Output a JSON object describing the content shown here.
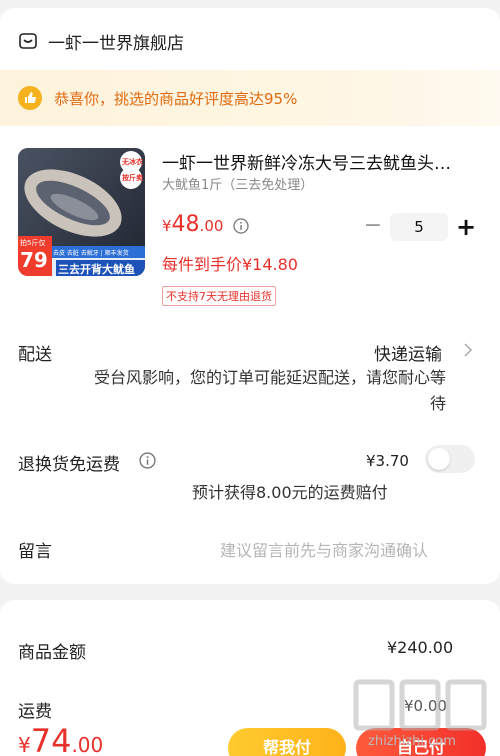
{
  "store": {
    "name": "一虾一世界旗舰店",
    "icon": "store-icon"
  },
  "banner": {
    "text": "恭喜你，挑选的商品好评度高达95%",
    "icon": "thumbs-up-icon"
  },
  "product": {
    "title": "一虾一世界新鲜冷冻大号三去鱿鱼头…",
    "spec": "大鱿鱼1斤（三去免处理）",
    "price_currency": "¥",
    "price_int": "48",
    "price_dec": ".00",
    "unit_price": "每件到手价¥14.80",
    "no_return_tag": "不支持7天无理由退货",
    "quantity": "5",
    "image": {
      "tag_top1": "无冰衣",
      "tag_top2": "按斤卖",
      "deal_small": "拍5斤仅",
      "deal_price": "79",
      "features": "去皮 去脏 去鱿牙 | 顺丰发货",
      "slogan": "三去开背大鱿鱼"
    }
  },
  "delivery": {
    "label": "配送",
    "method": "快递运输",
    "notice": "受台风影响，您的订单可能延迟配送，请您耐心等待"
  },
  "return_shipping": {
    "label": "退换货免运费",
    "price": "¥3.70",
    "note": "预计获得8.00元的运费赔付",
    "toggle_on": false
  },
  "message": {
    "label": "留言",
    "placeholder": "建议留言前先与商家沟通确认"
  },
  "summary": {
    "goods_label": "商品金额",
    "goods_value": "¥240.00",
    "shipping_label": "运费",
    "shipping_value": "¥0.00"
  },
  "footer": {
    "total_currency": "¥",
    "total_int": "74",
    "total_dec": ".00",
    "help_pay_label": "帮我付",
    "self_pay_label": "自己付"
  },
  "watermark": {
    "site": "zhizhizhi.com"
  },
  "colors": {
    "accent_red": "#e8302b",
    "banner_orange": "#e06a11",
    "help_yellow": "#ffbe22"
  }
}
